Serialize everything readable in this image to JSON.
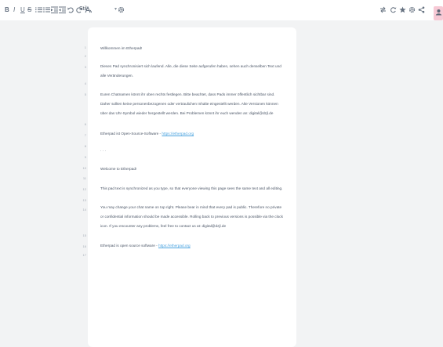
{
  "toolbar": {
    "bold": "B",
    "italic": "I",
    "underline": "U",
    "strikethrough": "S",
    "style_select": {
      "value": "Stil"
    }
  },
  "doc": {
    "line_numbers": [
      "1",
      "2",
      "3",
      "4",
      "5",
      "6",
      "7",
      "8",
      "9",
      "10",
      "11",
      "12",
      "13",
      "14",
      "15",
      "16",
      "17",
      "18",
      "19"
    ],
    "p1": "Willkommen im Etherpad!",
    "p2_l1": "Dieses Pad synchronisiert sich laufend. Alle, die diese Seite aufgerufen haben, sehen auch denselben Text und",
    "p2_l2": "alle Veränderungen.",
    "p3_l1": "Euren Chatnamen könnt ihr oben rechts festlegen. Bitte beachtet, dass Pads immer öffentlich sichtbar sind.",
    "p3_l2": "Daher sollten keine personenbezogenen oder vertraulichen Inhalte eingestellt werden. Alte Versionen können",
    "p3_l3": "über das Uhr-Symbol wieder hergestellt werden. Bei Problemen könnt ihr euch wenden an: digital@dzjl.de",
    "p4_text": "Etherpad ist Open-Source-Software - ",
    "p4_link": "https://etherpad.org",
    "sep": "· · ·",
    "p5": "Welcome to Etherpad!",
    "p6": "This pad text is synchronized as you type, so that everyone viewing this page sees the same text and all editing.",
    "p7_l1": "You may change your chat name on top right. Please bear in mind that every pad is public. Therefore no private",
    "p7_l2": "or confidential information should be made accessible. Rolling back to previous versions is possible via the clock",
    "p7_l3": "icon. If you encounter any problems, feel free to contact us at: digital@dzjl.de",
    "p8_text": "Etherpad is open source software - ",
    "p8_link": "https://etherpad.org"
  }
}
